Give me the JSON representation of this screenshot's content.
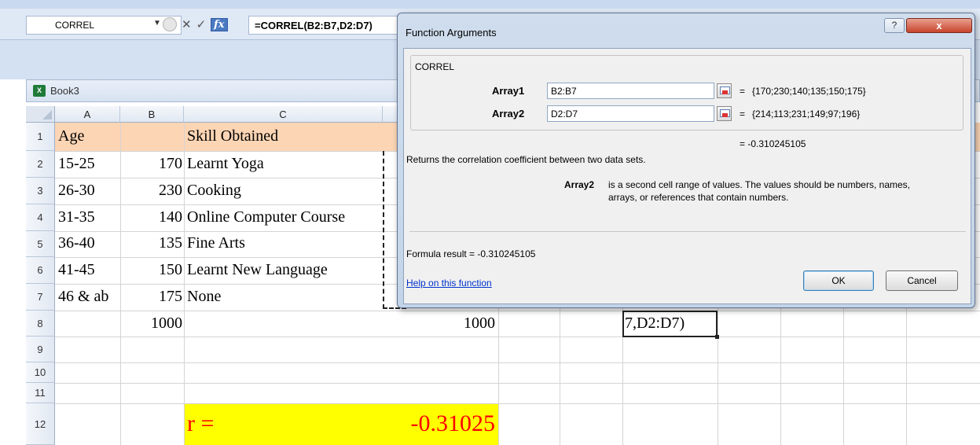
{
  "formula_bar": {
    "namebox": "CORREL",
    "cancel_symbol": "✕",
    "enter_symbol": "✓",
    "fx_symbol": "fx",
    "formula": "=CORREL(B2:B7,D2:D7)"
  },
  "workbook": {
    "title": "Book3",
    "columns": [
      "A",
      "B",
      "C"
    ],
    "rows": [
      "1",
      "2",
      "3",
      "4",
      "5",
      "6",
      "7",
      "8",
      "9",
      "10",
      "11",
      "12"
    ]
  },
  "sheet": {
    "row1": {
      "a": "Age",
      "c": "Skill Obtained"
    },
    "data": [
      {
        "a": "15-25",
        "b": "170",
        "c": "Learnt Yoga"
      },
      {
        "a": "26-30",
        "b": "230",
        "c": "Cooking"
      },
      {
        "a": "31-35",
        "b": "140",
        "c": "Online Computer Course"
      },
      {
        "a": "36-40",
        "b": "135",
        "c": "Fine Arts"
      },
      {
        "a": "41-45",
        "b": "150",
        "c": "Learnt New Language"
      },
      {
        "a": "46 & ab",
        "b": "175",
        "c": "None"
      }
    ],
    "row8": {
      "b": "1000",
      "d": "1000",
      "g": "7,D2:D7)"
    },
    "row12": {
      "c": "r =",
      "d": "-0.31025"
    }
  },
  "dialog": {
    "title": "Function Arguments",
    "help_btn": "?",
    "close_btn": "x",
    "function_name": "CORREL",
    "args": [
      {
        "label": "Array1",
        "value": "B2:B7",
        "result": "{170;230;140;135;150;175}"
      },
      {
        "label": "Array2",
        "value": "D2:D7",
        "result": "{214;113;231;149;97;196}"
      }
    ],
    "equals": "=",
    "overall_result": "= -0.310245105",
    "description": "Returns the correlation coefficient between two data sets.",
    "arg_help_name": "Array2",
    "arg_help_line1": "is a second cell range of values. The values should be numbers, names,",
    "arg_help_line2": "arrays, or references that contain numbers.",
    "formula_result": "Formula result =   -0.310245105",
    "help_link": "Help on this function",
    "ok": "OK",
    "cancel": "Cancel"
  },
  "colors": {
    "header_fill": "#fcd5b4",
    "result_fill": "#ffff00",
    "result_text": "#ff0000"
  }
}
